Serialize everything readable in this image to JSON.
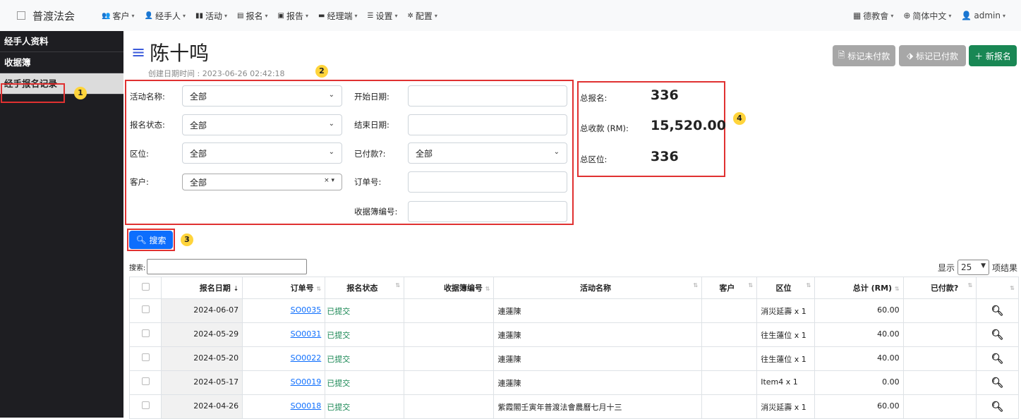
{
  "brand": {
    "name": "普渡法会",
    "logo_icon": "image-icon"
  },
  "menu": [
    {
      "icon": "👥",
      "label": "客户"
    },
    {
      "icon": "👤",
      "label": "经手人"
    },
    {
      "icon": "▮▮",
      "label": "活动"
    },
    {
      "icon": "▤",
      "label": "报名"
    },
    {
      "icon": "▣",
      "label": "报告"
    },
    {
      "icon": "▬",
      "label": "经理端"
    },
    {
      "icon": "☰",
      "label": "设置"
    },
    {
      "icon": "✲",
      "label": "配置"
    }
  ],
  "topright": {
    "org": "德教會",
    "language": "简体中文",
    "user": "admin"
  },
  "sidebar": {
    "items": [
      "经手人资料",
      "收据簿",
      "经手报名记录"
    ]
  },
  "badges": [
    "1",
    "2",
    "3",
    "4"
  ],
  "page": {
    "title": "陈十鸣",
    "created": "创建日期时间 : 2023-06-26 02:42:18"
  },
  "actions": {
    "mark_unpaid": "标记未付款",
    "mark_paid": "标记已付款",
    "new": "新报名"
  },
  "filters": {
    "activity_label": "活动名称:",
    "activity_value": "全部",
    "status_label": "报名状态:",
    "status_value": "全部",
    "zone_label": "区位:",
    "zone_value": "全部",
    "customer_label": "客户:",
    "customer_value": "全部",
    "start_label": "开始日期:",
    "end_label": "结束日期:",
    "paid_label": "已付款?:",
    "paid_value": "全部",
    "order_label": "订单号:",
    "receipt_label": "收据簿编号:"
  },
  "stats": {
    "total_reg_label": "总报名:",
    "total_reg_value": "336",
    "total_income_label": "总收款 (RM):",
    "total_income_value": "15,520.00",
    "total_zone_label": "总区位:",
    "total_zone_value": "336"
  },
  "search_button": "搜索",
  "table_search_label": "搜索:",
  "show": {
    "prefix": "显示",
    "value": "25",
    "suffix": "项结果"
  },
  "table": {
    "headers": [
      "报名日期",
      "订单号",
      "报名状态",
      "收据簿编号",
      "活动名称",
      "客户",
      "区位",
      "总计 (RM)",
      "已付款?"
    ],
    "rows": [
      {
        "date": "2024-06-07",
        "order": "SO0035",
        "status": "已提交",
        "receipt": "",
        "activity": "連蓮陳",
        "customer": "",
        "zone": "消災延壽 x 1",
        "total": "60.00",
        "paid": ""
      },
      {
        "date": "2024-05-29",
        "order": "SO0031",
        "status": "已提交",
        "receipt": "",
        "activity": "連蓮陳",
        "customer": "",
        "zone": "往生蓮位 x 1",
        "total": "40.00",
        "paid": ""
      },
      {
        "date": "2024-05-20",
        "order": "SO0022",
        "status": "已提交",
        "receipt": "",
        "activity": "連蓮陳",
        "customer": "",
        "zone": "往生蓮位 x 1",
        "total": "40.00",
        "paid": ""
      },
      {
        "date": "2024-05-17",
        "order": "SO0019",
        "status": "已提交",
        "receipt": "",
        "activity": "連蓮陳",
        "customer": "",
        "zone": "Item4 x 1",
        "total": "0.00",
        "paid": ""
      },
      {
        "date": "2024-04-26",
        "order": "SO0018",
        "status": "已提交",
        "receipt": "",
        "activity": "紫霞閣壬寅年普渡法會農曆七月十三",
        "customer": "",
        "zone": "消災延壽 x 1",
        "total": "60.00",
        "paid": ""
      }
    ]
  },
  "colors": {
    "sidebar": "#1e1e22",
    "accent_blue": "#0d6efd",
    "green": "#198754",
    "highlight": "#e03131",
    "badge": "#ffd43b"
  }
}
